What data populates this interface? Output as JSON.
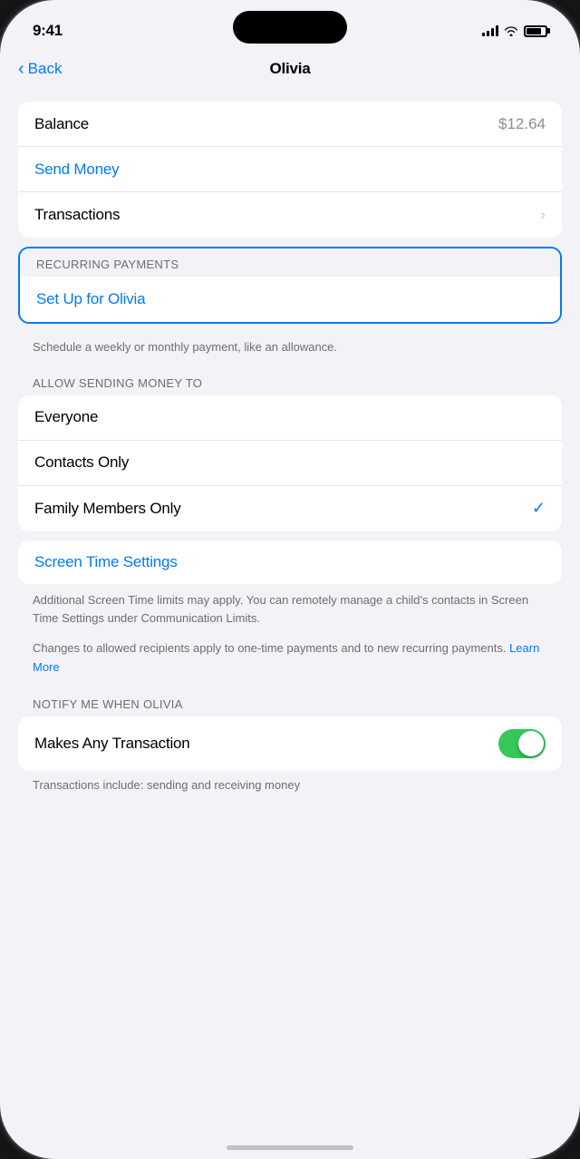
{
  "statusBar": {
    "time": "9:41"
  },
  "navBar": {
    "back": "Back",
    "title": "Olivia"
  },
  "balanceSection": {
    "balanceLabel": "Balance",
    "balanceValue": "$12.64",
    "sendMoneyLabel": "Send Money",
    "transactionsLabel": "Transactions"
  },
  "recurringSection": {
    "sectionHeader": "RECURRING PAYMENTS",
    "setupLabel": "Set Up for Olivia",
    "footerText": "Schedule a weekly or monthly payment, like an allowance."
  },
  "allowSection": {
    "sectionHeader": "ALLOW SENDING MONEY TO",
    "options": [
      {
        "label": "Everyone",
        "selected": false
      },
      {
        "label": "Contacts Only",
        "selected": false
      },
      {
        "label": "Family Members Only",
        "selected": true
      }
    ]
  },
  "screenTimeRow": {
    "label": "Screen Time Settings"
  },
  "footerNotes": {
    "text1": "Additional Screen Time limits may apply. You can remotely manage a child's contacts in Screen Time Settings under Communication Limits.",
    "text2": "Changes to allowed recipients apply to one-time payments and to new recurring payments.",
    "learnMore": "Learn More"
  },
  "notifySection": {
    "sectionHeader": "NOTIFY ME WHEN OLIVIA",
    "toggleLabel": "Makes Any Transaction",
    "toggleOn": true
  },
  "bottomNote": {
    "text": "Transactions include: sending and receiving money"
  }
}
